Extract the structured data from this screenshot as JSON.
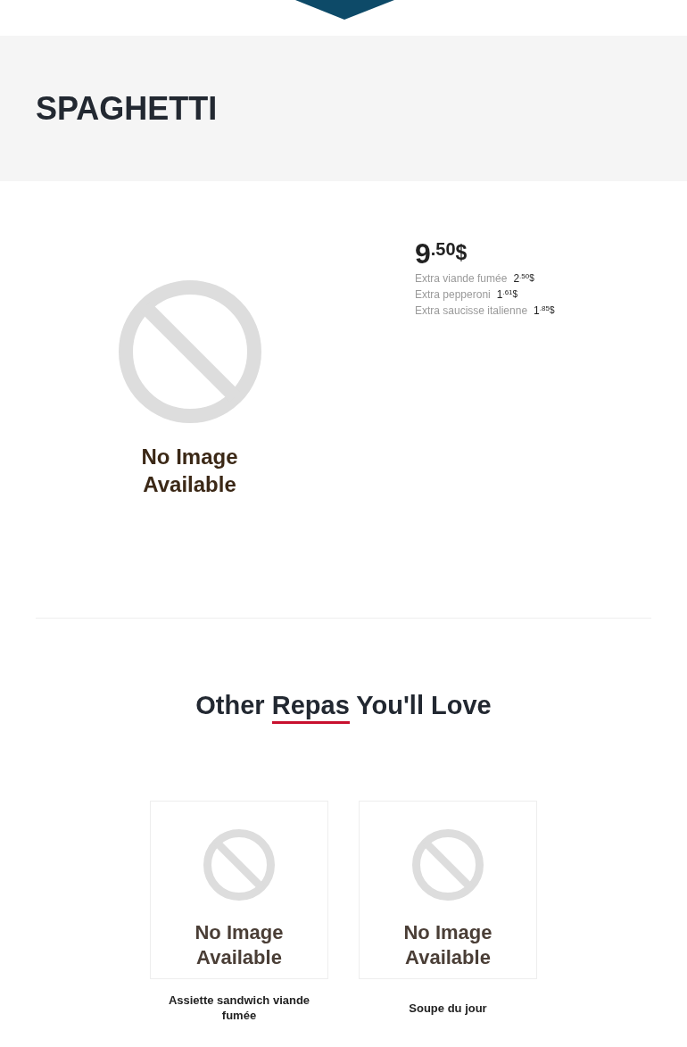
{
  "page_title": "SPAGHETTI",
  "product": {
    "image": {
      "lines": [
        "No Image",
        "Available"
      ]
    },
    "price": {
      "whole": "9",
      "cents": ".50",
      "currency": "$"
    },
    "extras": [
      {
        "name": "Extra viande fumée",
        "whole": "2",
        "cents": ".50",
        "currency": "$"
      },
      {
        "name": "Extra pepperoni",
        "whole": "1",
        "cents": ".61",
        "currency": "$"
      },
      {
        "name": "Extra saucisse italienne",
        "whole": "1",
        "cents": ".85",
        "currency": "$"
      }
    ]
  },
  "related": {
    "heading": {
      "before": "Other",
      "highlight": "Repas",
      "after": "You'll Love"
    },
    "items": [
      {
        "title": "Assiette sandwich viande fumée",
        "image": {
          "lines": [
            "No Image",
            "Available"
          ]
        }
      },
      {
        "title": "Soupe du jour",
        "image": {
          "lines": [
            "No Image",
            "Available"
          ]
        }
      }
    ]
  }
}
